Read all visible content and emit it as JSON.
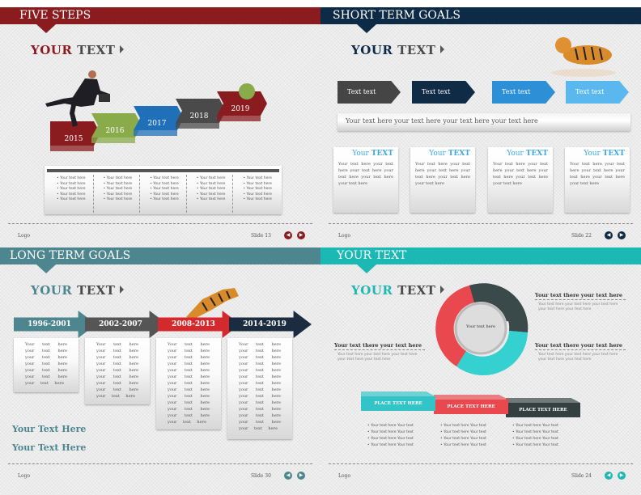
{
  "colors": {
    "s1": "#8a1c1f",
    "s2": "#0d2a46",
    "s3": "#4e8690",
    "s4": "#1cb8b4"
  },
  "slides": [
    {
      "header": "FIVE STEPS",
      "your": "YOUR",
      "text": "TEXT",
      "logo": "Logo",
      "slide_no": "Slide 13",
      "steps": [
        {
          "label": "2015",
          "color": "#8a1c1f"
        },
        {
          "label": "2016",
          "color": "#8aab4a"
        },
        {
          "label": "2017",
          "color": "#1f70b8"
        },
        {
          "label": "2018",
          "color": "#4a4a4a"
        },
        {
          "label": "2019",
          "color": "#8a1c1f"
        }
      ],
      "columns": [
        [
          "Your text here",
          "Your text here",
          "Your text here",
          "Your text here",
          "Your text here"
        ],
        [
          "Your text here",
          "Your text here",
          "Your text here",
          "Your text here",
          "Your text here"
        ],
        [
          "Your text here",
          "Your text here",
          "Your text here",
          "Your text here",
          "Your text here"
        ],
        [
          "Your text here",
          "Your text here",
          "Your text here",
          "Your text here",
          "Your text here"
        ],
        [
          "Your text here",
          "Your text here",
          "Your text here",
          "Your text here",
          "Your text here"
        ]
      ]
    },
    {
      "header": "SHORT TERM GOALS",
      "your": "YOUR",
      "text": "TEXT",
      "logo": "Logo",
      "slide_no": "Slide 22",
      "arrows": [
        {
          "label": "Text text",
          "color": "#454545"
        },
        {
          "label": "Text text",
          "color": "#0f2b46"
        },
        {
          "label": "Text text",
          "color": "#2d8fd6"
        },
        {
          "label": "Text text",
          "color": "#5ab8ee"
        }
      ],
      "banner": "Your text here your text here your text here your text here",
      "cards": [
        {
          "t1": "Your",
          "t2": "TEXT",
          "body": "Your text here your text here your text here your text here your text here your text here"
        },
        {
          "t1": "Your",
          "t2": "TEXT",
          "body": "Your text here your text here your text here your text here your text here your text here"
        },
        {
          "t1": "Your",
          "t2": "TEXT",
          "body": "Your text here your text here your text here your text here your text here your text here"
        },
        {
          "t1": "Your",
          "t2": "TEXT",
          "body": "Your text here your text here your text here your text here your text here your text here"
        }
      ]
    },
    {
      "header": "LONG TERM GOALS",
      "your": "YOUR",
      "text": "TEXT",
      "logo": "Logo",
      "slide_no": "Slide 30",
      "arrows": [
        {
          "label": "1996-2001",
          "color": "#4e8690"
        },
        {
          "label": "2002-2007",
          "color": "#555555"
        },
        {
          "label": "2008-2013",
          "color": "#d42a2e"
        },
        {
          "label": "2014-2019",
          "color": "#1c2c40"
        }
      ],
      "cards": [
        "Your text here your text here your text here your text here your text here your text here your text here",
        "Your text here your text here your text here your text here your text here your text here your text here your text here your text here",
        "Your text here your text here your text here your text here your text here your text here your text here your text here your text here your text here your text here your text here your text here",
        "Your text here your text here your text here your text here your text here your text here your text here your text here your text here your text here your text here your text here your text here your text here"
      ],
      "links": [
        "Your Text Here",
        "Your Text Here"
      ]
    },
    {
      "header": "YOUR TEXT",
      "your": "YOUR",
      "text": "TEXT",
      "logo": "Logo",
      "slide_no": "Slide 24",
      "center": "Your text here",
      "blocks": [
        {
          "title": "Your text there your text here",
          "body": "Your text here your text here your text here your text here your text here"
        },
        {
          "title": "Your text there your text here",
          "body": "Your text here your text here your text here your text here your text here"
        },
        {
          "title": "Your text there your text here",
          "body": "Your text here your text here your text here your text here your text here"
        }
      ],
      "places": [
        {
          "label": "PLACE TEXT HERE",
          "color": "#33c4c8"
        },
        {
          "label": "PLACE TEXT HERE",
          "color": "#e8484e"
        },
        {
          "label": "PLACE TEXT HERE",
          "color": "#34403f"
        }
      ],
      "bullets": [
        [
          "Your text here Your text",
          "Your text here Your text",
          "Your text here Your text",
          "Your text here Your text"
        ],
        [
          "Your text here Your text",
          "Your text here Your text",
          "Your text here Your text",
          "Your text here Your text"
        ],
        [
          "Your text here Your text",
          "Your text here Your text",
          "Your text here Your text",
          "Your text here Your text"
        ]
      ]
    }
  ]
}
